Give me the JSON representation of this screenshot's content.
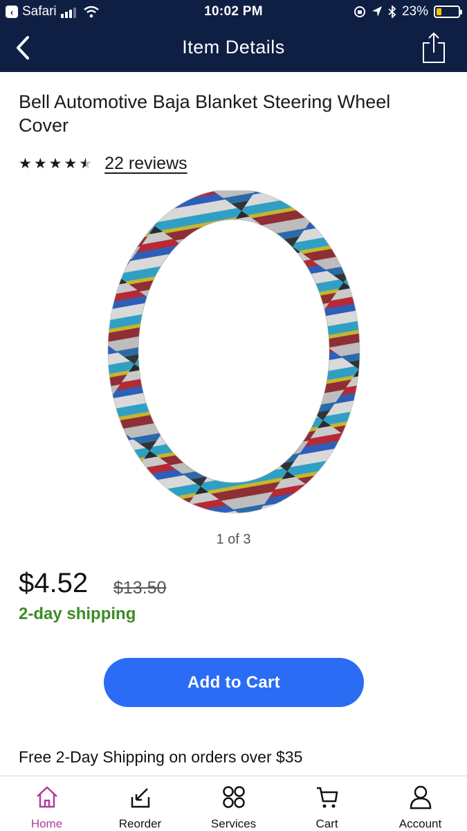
{
  "status_bar": {
    "back_app": "Safari",
    "time": "10:02 PM",
    "battery": "23%",
    "battery_level": 0.23
  },
  "nav": {
    "title": "Item Details"
  },
  "product": {
    "title": "Bell Automotive Baja Blanket Steering Wheel Cover",
    "rating": 4.5,
    "reviews": "22 reviews",
    "image_pager": "1 of 3",
    "price": "$4.52",
    "was_price": "$13.50",
    "shipping": "2-day shipping",
    "add_to_cart": "Add to Cart",
    "promo": "Free 2-Day Shipping on orders over $35"
  },
  "tabs": [
    {
      "label": "Home",
      "icon": "home-icon",
      "active": true
    },
    {
      "label": "Reorder",
      "icon": "reorder-icon",
      "active": false
    },
    {
      "label": "Services",
      "icon": "services-icon",
      "active": false
    },
    {
      "label": "Cart",
      "icon": "cart-icon",
      "active": false
    },
    {
      "label": "Account",
      "icon": "account-icon",
      "active": false
    }
  ],
  "colors": {
    "header": "#0f1f44",
    "button": "#2b6cf5",
    "shipping": "#3d8b25",
    "active_tab": "#b13a9c"
  }
}
